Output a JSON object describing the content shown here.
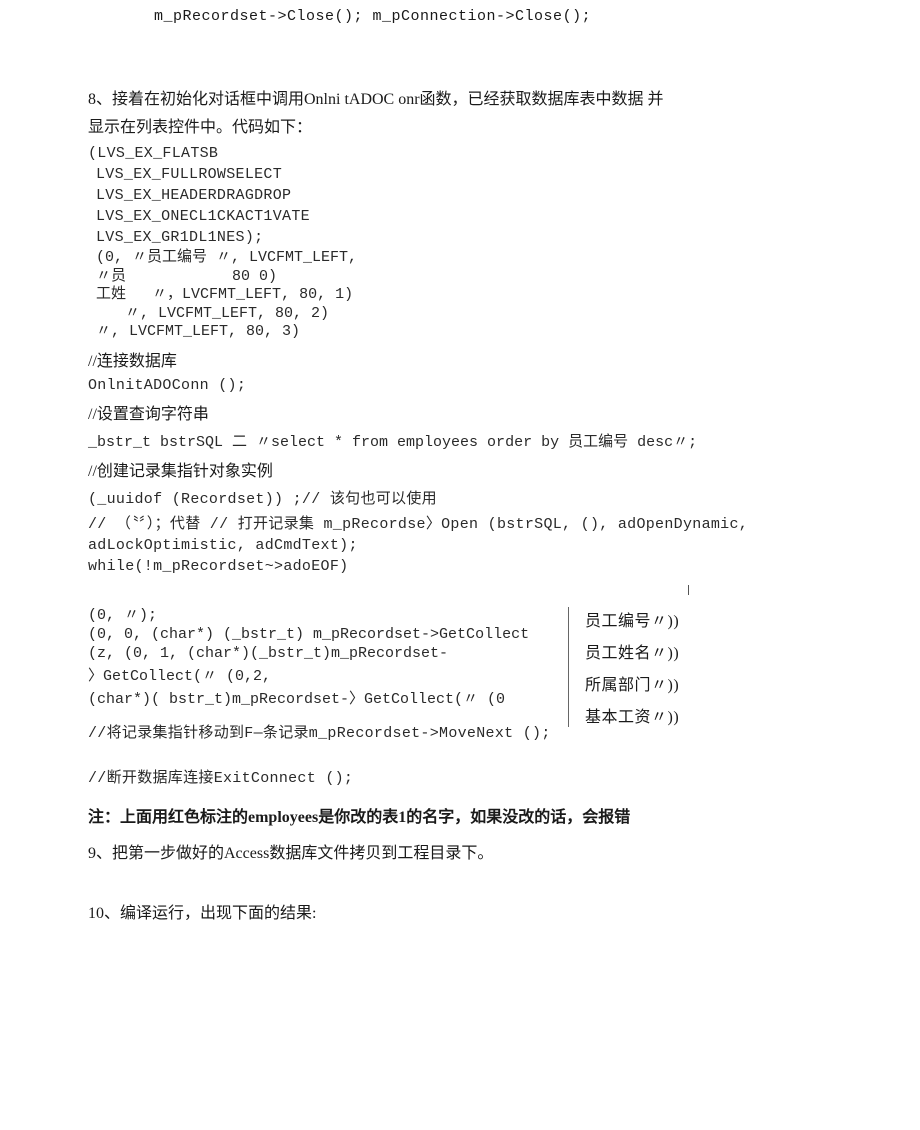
{
  "topLine": "m_pRecordset->Close();  m_pConnection->Close();",
  "p8_line1": "8、接着在初始化对话框中调用Onlni tADOC onr函数，已经获取数据库表中数据  并",
  "p8_line2": "显示在列表控件中。代码如下：",
  "code_block1": [
    "(LVS_EX_FLATSB",
    " LVS_EX_FULLROWSELECT",
    " LVS_EX_HEADERDRAGDROP",
    " LVS_EX_ONECL1CKACT1VATE",
    " LVS_EX_GR1DL1NES);"
  ],
  "overlap": {
    "r1": "(0, 〃员工编号  〃,  LVCFMT_LEFT,",
    "r2a": "〃员",
    "r2b": "80   0)",
    "r3a": "工姓",
    "r3b": "〃，LVCFMT_LEFT,  80,  1)",
    "r4": "〃,  LVCFMT_LEFT,  80,  2)",
    "r5": "〃,  LVCFMT_LEFT,  80,  3)"
  },
  "comment1": "//连接数据库",
  "line_oninit": "OnlnitADOConn ();",
  "comment2": "//设置查询字符串",
  "sql_line": "_bstr_t bstrSQL 二 〃select * from employees order by 员工编号 desc〃;",
  "comment3": "//创建记录集指针对象实例",
  "uuidof_line": "(_uuidof (Recordset)) ;//  该句也可以使用",
  "open_line1": "// （〝〞）；代替  //  打开记录集 m_pRecordse〉Open (bstrSQL,  (),  adOpenDynamic,",
  "open_line2": "adLockOptimistic,  adCmdText);",
  "while_line": "while(!m_pRecordset~>adoEOF)",
  "leftcol": [
    "(0, 〃);",
    "(0,  0,  (char*) (_bstr_t) m_pRecordset->GetCollect",
    "(z,   (0,  1,  (char*)(_bstr_t)m_pRecordset-",
    "〉GetCollect(〃  (0,2,",
    "(char*)( bstr_t)m_pRecordset-〉GetCollect(〃   (0"
  ],
  "rightcol": [
    "员工编号〃))",
    "员工姓名〃))",
    "所属部门〃))",
    "基本工资〃))"
  ],
  "move_line": "//将记录集指针移动到F—条记录m_pRecordset->MoveNext ();",
  "exit_line": "//断开数据库连接ExitConnect ();",
  "note": "注：上面用红色标注的employees是你改的表1的名字，如果没改的话，会报错",
  "p9": "9、把第一步做好的Access数据库文件拷贝到工程目录下。",
  "p10": "10、编译运行，出现下面的结果:"
}
